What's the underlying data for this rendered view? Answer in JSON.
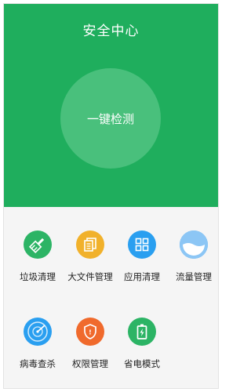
{
  "header": {
    "title": "安全中心",
    "scan_button": "一键检测"
  },
  "tools": [
    {
      "label": "垃圾清理",
      "icon": "broom-icon",
      "color": "#2cb465"
    },
    {
      "label": "大文件管理",
      "icon": "file-stack-icon",
      "color": "#f1b12b"
    },
    {
      "label": "应用清理",
      "icon": "app-grid-icon",
      "color": "#2a9ff0"
    },
    {
      "label": "流量管理",
      "icon": "data-usage-icon",
      "color": "#4aa6f0"
    },
    {
      "label": "病毒查杀",
      "icon": "radar-icon",
      "color": "#2a9ff0"
    },
    {
      "label": "权限管理",
      "icon": "shield-icon",
      "color": "#f06a2c"
    },
    {
      "label": "省电模式",
      "icon": "battery-icon",
      "color": "#2cb465"
    }
  ],
  "colors": {
    "header_bg": "#1fae5d",
    "scan_circle": "#49c07c",
    "body_bg": "#f5f5f5"
  }
}
